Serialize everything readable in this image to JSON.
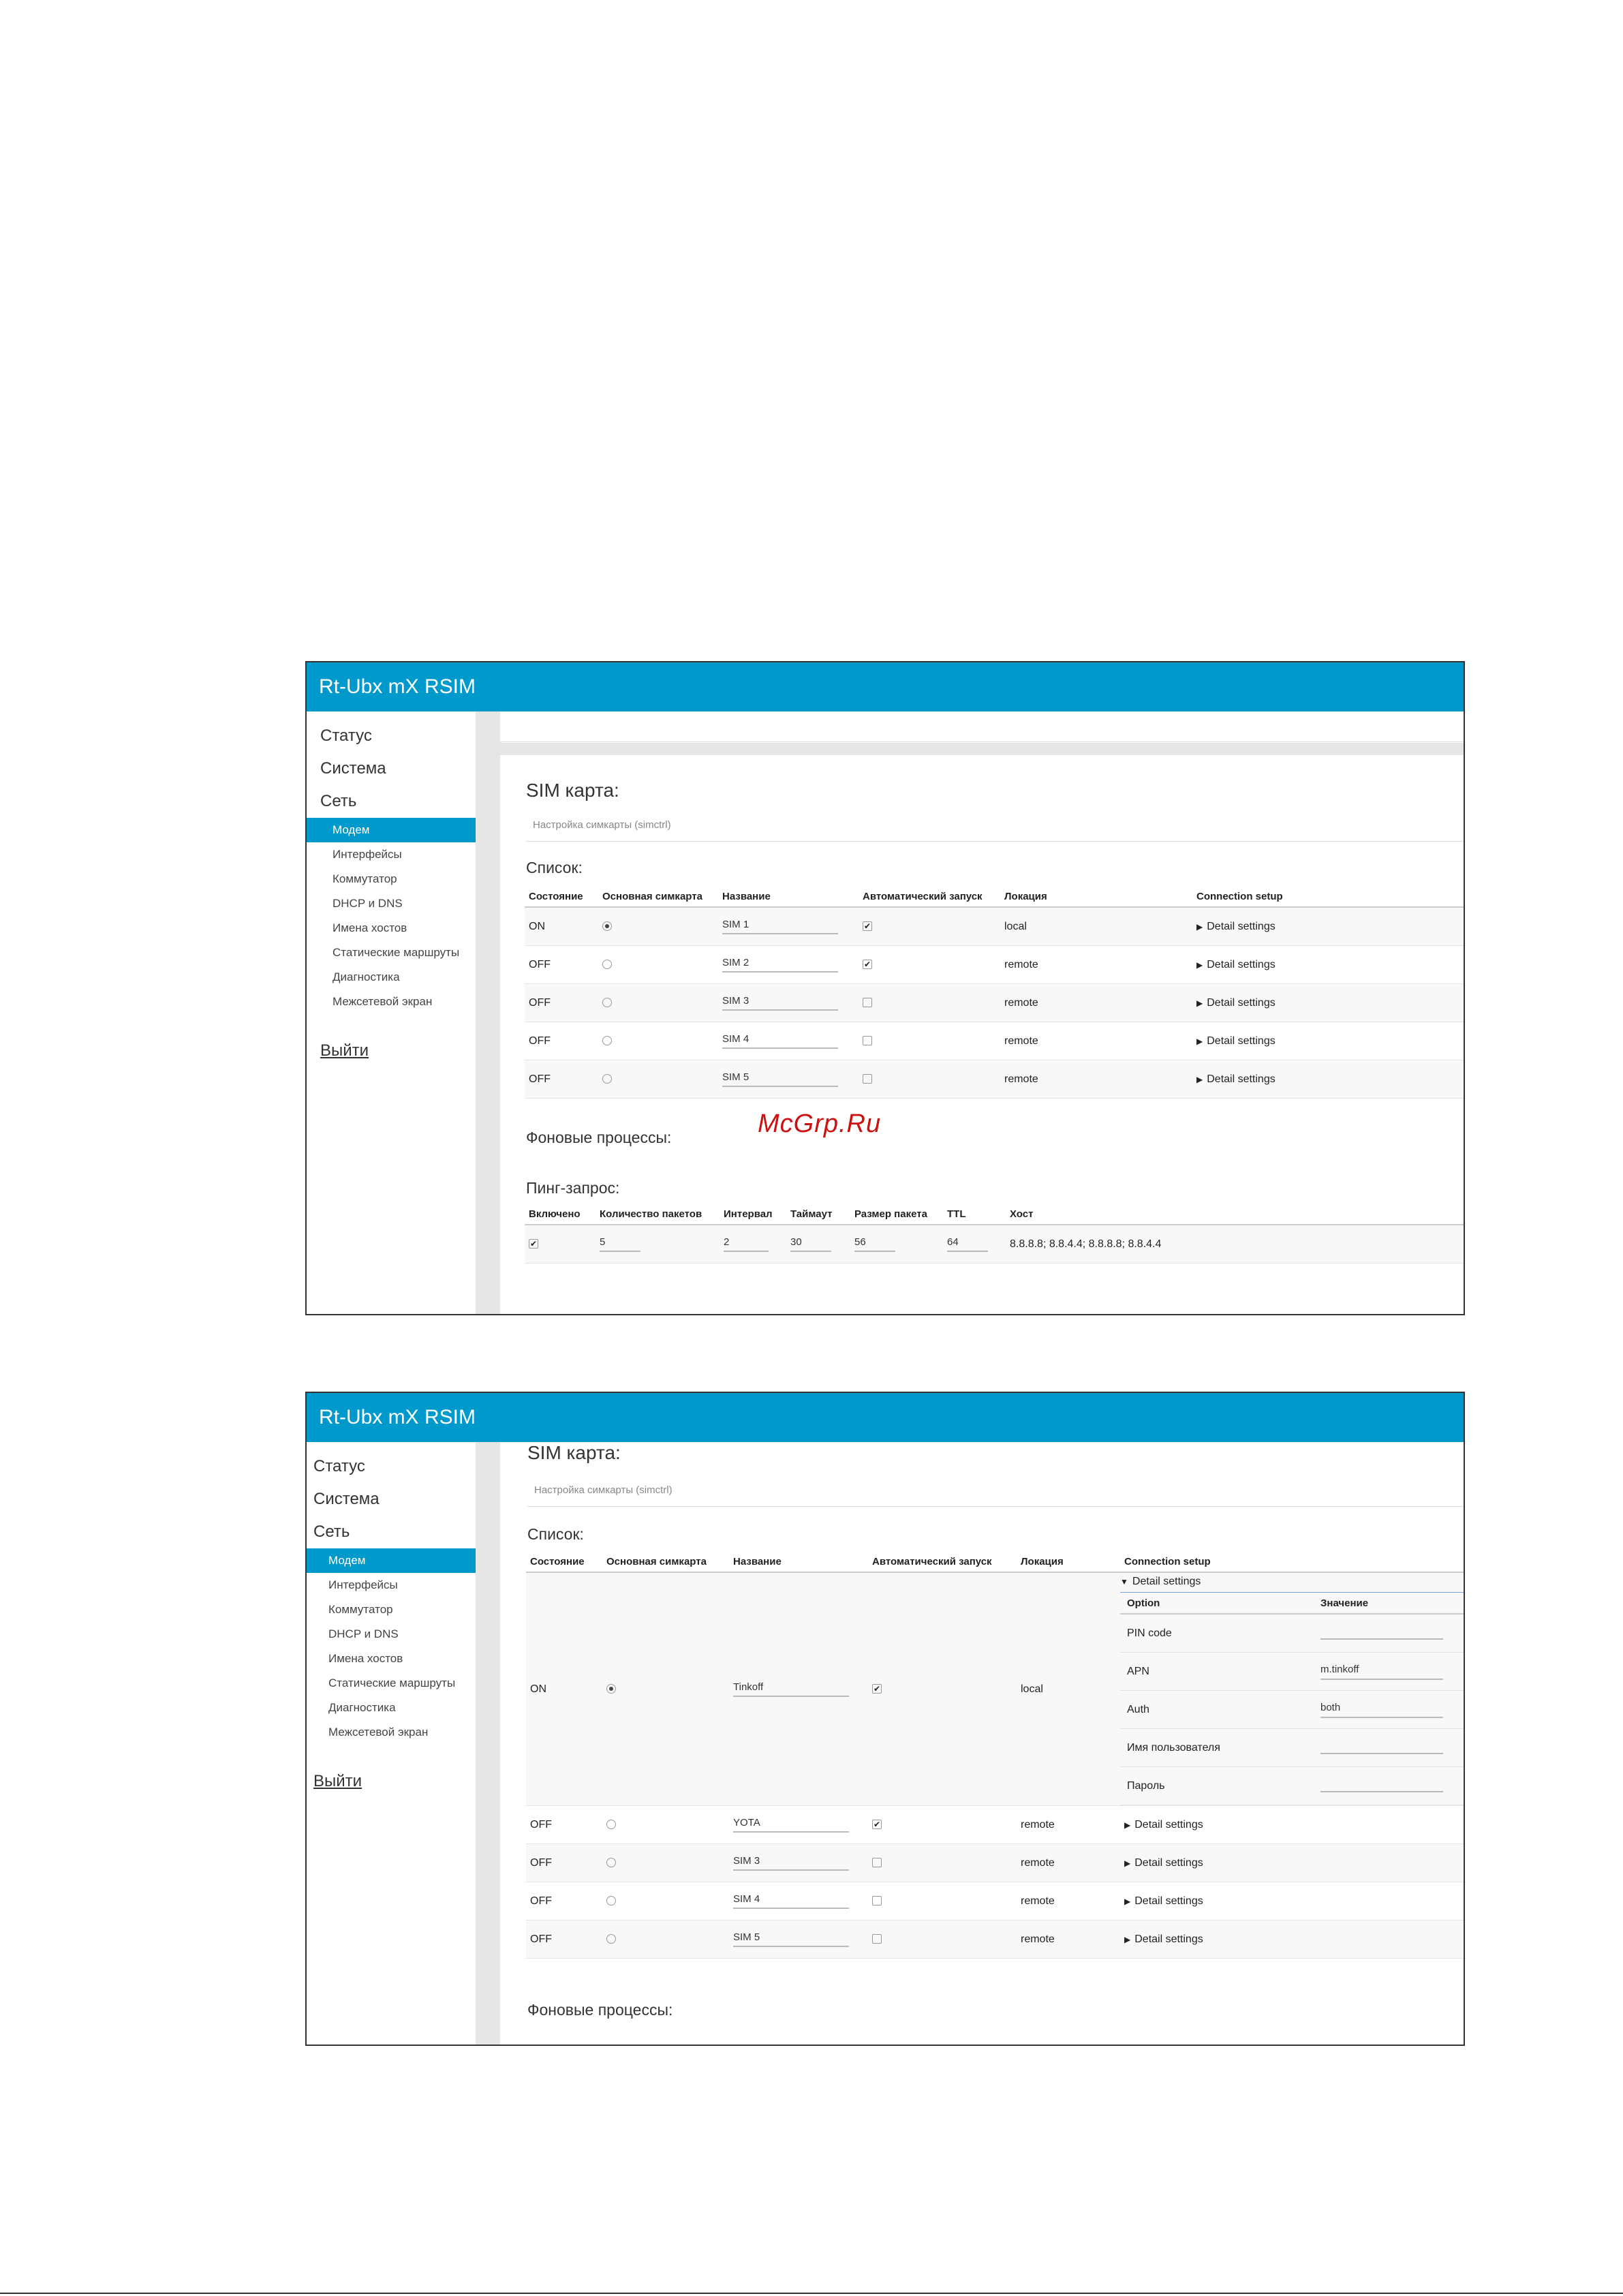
{
  "app": {
    "title": "Rt-Ubx mX RSIM"
  },
  "nav": {
    "top": [
      "Статус",
      "Система",
      "Сеть"
    ],
    "sub": [
      "Модем",
      "Интерфейсы",
      "Коммутатор",
      "DHCP и DNS",
      "Имена хостов",
      "Статические маршруты",
      "Диагностика",
      "Межсетевой экран"
    ],
    "active": "Модем",
    "logout": "Выйти"
  },
  "section": {
    "title": "SIM карта:",
    "subtitle": "Настройка симкарты (simctrl)",
    "list_title": "Список:",
    "background_title": "Фоновые процессы:",
    "ping_title": "Пинг-запрос:"
  },
  "sim_table": {
    "headers": [
      "Состояние",
      "Основная симкарта",
      "Название",
      "Автоматический запуск",
      "Локация",
      "Connection setup"
    ],
    "detail_label": "Detail settings"
  },
  "shot1": {
    "rows": [
      {
        "state": "ON",
        "primary": true,
        "name": "SIM 1",
        "auto": true,
        "location": "local"
      },
      {
        "state": "OFF",
        "primary": false,
        "name": "SIM 2",
        "auto": true,
        "location": "remote"
      },
      {
        "state": "OFF",
        "primary": false,
        "name": "SIM 3",
        "auto": false,
        "location": "remote"
      },
      {
        "state": "OFF",
        "primary": false,
        "name": "SIM 4",
        "auto": false,
        "location": "remote"
      },
      {
        "state": "OFF",
        "primary": false,
        "name": "SIM 5",
        "auto": false,
        "location": "remote"
      }
    ]
  },
  "ping": {
    "headers": [
      "Включено",
      "Количество пакетов",
      "Интервал",
      "Таймаут",
      "Размер пакета",
      "TTL",
      "Хост"
    ],
    "enabled": true,
    "count": "5",
    "interval": "2",
    "timeout": "30",
    "size": "56",
    "ttl": "64",
    "host": "8.8.8.8; 8.8.4.4; 8.8.8.8; 8.8.4.4"
  },
  "shot2": {
    "rows": [
      {
        "state": "ON",
        "primary": true,
        "name": "Tinkoff",
        "auto": true,
        "location": "local",
        "expanded": true
      },
      {
        "state": "OFF",
        "primary": false,
        "name": "YOTA",
        "auto": true,
        "location": "remote"
      },
      {
        "state": "OFF",
        "primary": false,
        "name": "SIM 3",
        "auto": false,
        "location": "remote"
      },
      {
        "state": "OFF",
        "primary": false,
        "name": "SIM 4",
        "auto": false,
        "location": "remote"
      },
      {
        "state": "OFF",
        "primary": false,
        "name": "SIM 5",
        "auto": false,
        "location": "remote"
      }
    ],
    "detail": {
      "headers": [
        "Option",
        "Значение"
      ],
      "options": [
        {
          "option": "PIN code",
          "value": ""
        },
        {
          "option": "APN",
          "value": "m.tinkoff"
        },
        {
          "option": "Auth",
          "value": "both"
        },
        {
          "option": "Имя пользователя",
          "value": ""
        },
        {
          "option": "Пароль",
          "value": ""
        }
      ]
    }
  },
  "watermark": "McGrp.Ru"
}
